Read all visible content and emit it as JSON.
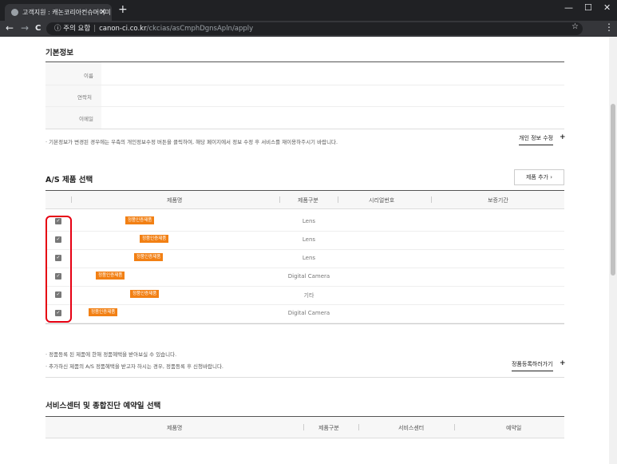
{
  "browser": {
    "tab_title": "고객지원 : 캐논코리아컨슈머이미",
    "tab_close": "✕",
    "new_tab": "+",
    "window_controls": [
      "—",
      "☐",
      "✕"
    ],
    "nav": {
      "back": "←",
      "forward": "→",
      "reload": "C"
    },
    "security_icon": "ⓘ",
    "security_label": "주의 요함",
    "url_domain": "canon-ci.co.kr",
    "url_path": "/ckcias/asCmphDgnsApln/apply",
    "star": "☆",
    "menu": "⋮"
  },
  "basic_info": {
    "title": "기본정보",
    "fields": [
      "이름",
      "연락처",
      "이메일"
    ],
    "notice": "· 기본정보가 변경된 경우에는 우측의 개인정보수정 버튼을 클릭하여, 해당 페이지에서 정보 수정 후 서비스를 재이용하주시기 바랍니다.",
    "edit_link": "개인 정보 수정",
    "edit_plus": "+"
  },
  "as_products": {
    "title": "A/S 제품 선택",
    "add_button": "제품 추가  ›",
    "columns": [
      "제품명",
      "제품구분",
      "시리얼번호",
      "보증기간"
    ],
    "rows": [
      {
        "checked": "✓",
        "tag": "정품인증제품",
        "type": "Lens"
      },
      {
        "checked": "✓",
        "tag": "정품인증제품",
        "type": "Lens"
      },
      {
        "checked": "✓",
        "tag": "정품인증제품",
        "type": "Lens"
      },
      {
        "checked": "✓",
        "tag": "정품인증제품",
        "type": "Digital Camera"
      },
      {
        "checked": "✓",
        "tag": "정품인증제품",
        "type": "기타"
      },
      {
        "checked": "✓",
        "tag": "정품인증제품",
        "type": "Digital Camera"
      }
    ],
    "notices": [
      "· 정품등록 된 제품에 한해 정품혜택을 받아보실 수 있습니다.",
      "· 추가하신 제품의 A/S 정품혜택을 받고자 하시는 경우, 정품등록 후 신청바랍니다."
    ],
    "register_link": "정품등록하러가기",
    "register_plus": "+"
  },
  "reservation": {
    "title": "서비스센터 및 종합진단 예약일 선택",
    "columns": [
      "제품명",
      "제품구분",
      "서비스센터",
      "예약일"
    ]
  },
  "colors": {
    "accent": "#f28014",
    "highlight": "#e60012"
  }
}
